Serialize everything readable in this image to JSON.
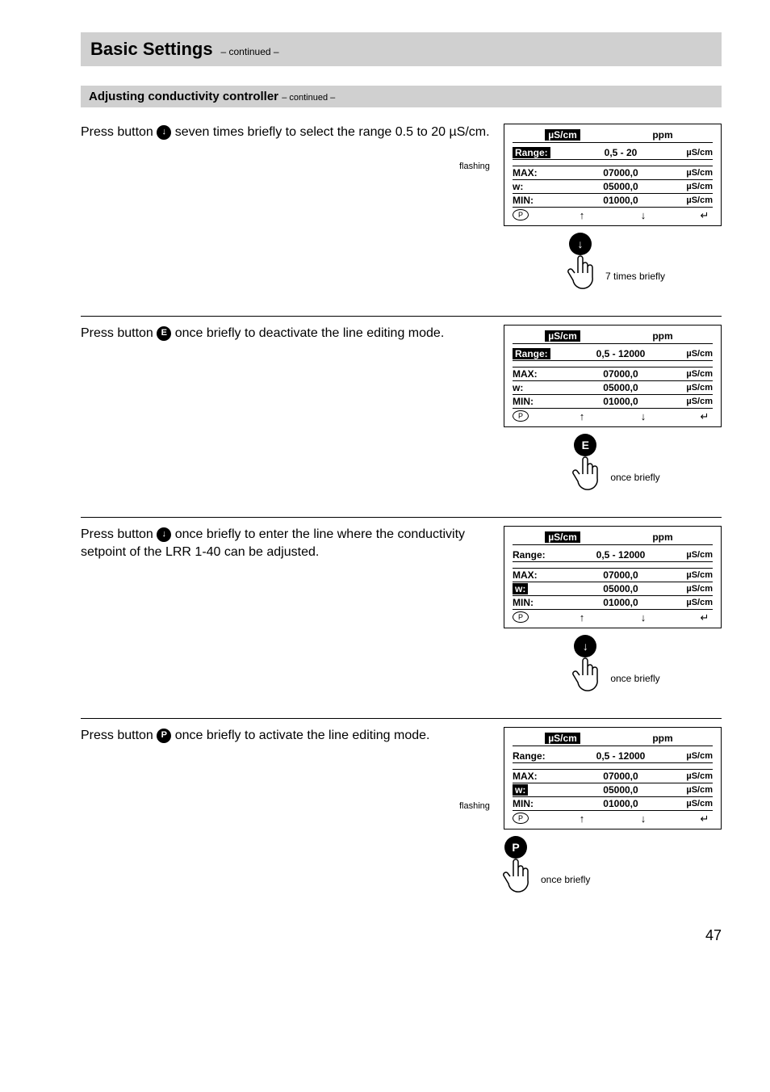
{
  "page": {
    "title": "Basic Settings",
    "title_cont": "– continued –",
    "subtitle": "Adjusting conductivity controller",
    "subtitle_cont": "– continued –",
    "page_number": "47"
  },
  "labels": {
    "flashing": "flashing",
    "uscm": "µS/cm",
    "ppm": "ppm",
    "range": "Range:",
    "max": "MAX:",
    "w": "w:",
    "min": "MIN:"
  },
  "sections": [
    {
      "instruction_pre": "Press button ",
      "instruction_btn": "↓",
      "instruction_post": " seven times briefly to select the range 0.5 to 20 µS/cm.",
      "flashing": true,
      "lcd": {
        "top_hl_left": true,
        "range_hl": true,
        "range_value": "0,5 - 20",
        "max": "07000,0",
        "w_hl": false,
        "w": "05000,0",
        "min": "01000,0"
      },
      "press": {
        "btn": "↓",
        "caption": "7 times briefly",
        "btn_type": "arrow"
      }
    },
    {
      "instruction_pre": "Press button ",
      "instruction_btn": "E",
      "instruction_post": " once briefly to deactivate the line editing mode.",
      "flashing": false,
      "lcd": {
        "top_hl_left": true,
        "range_hl": true,
        "range_value": "0,5 - 12000",
        "max": "07000,0",
        "w_hl": false,
        "w": "05000,0",
        "min": "01000,0"
      },
      "press": {
        "btn": "E",
        "caption": "once briefly",
        "btn_type": "letter"
      }
    },
    {
      "instruction_pre": "Press button ",
      "instruction_btn": "↓",
      "instruction_post": " once briefly to enter the line where the conductivity setpoint of the LRR 1-40 can be adjusted.",
      "flashing": false,
      "lcd": {
        "top_hl_left": true,
        "range_hl": false,
        "range_value": "0,5 - 12000",
        "max": "07000,0",
        "w_hl": true,
        "w": "05000,0",
        "min": "01000,0"
      },
      "press": {
        "btn": "↓",
        "caption": "once briefly",
        "btn_type": "arrow"
      }
    },
    {
      "instruction_pre": "Press button ",
      "instruction_btn": "P",
      "instruction_post": " once briefly to activate the line editing mode.",
      "flashing": true,
      "lcd": {
        "top_hl_left": true,
        "range_hl": false,
        "range_value": "0,5 - 12000",
        "max": "07000,0",
        "w_hl": true,
        "w": "05000,0",
        "min": "01000,0"
      },
      "press": {
        "btn": "P",
        "caption": "once briefly",
        "btn_type": "letter",
        "position": "left"
      }
    }
  ]
}
